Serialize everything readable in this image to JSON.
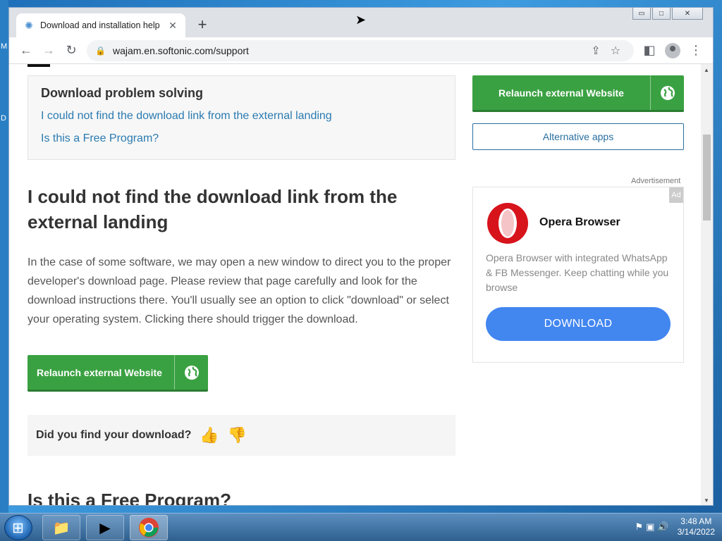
{
  "desktop": {
    "edge_letters": [
      "M",
      "D"
    ]
  },
  "browser": {
    "tab": {
      "title": "Download and installation help",
      "close": "✕",
      "favicon": "softonic-icon"
    },
    "new_tab": "+",
    "window_controls": {
      "minimize": "▭",
      "maximize": "□",
      "close": "✕"
    },
    "nav": {
      "back": "←",
      "forward": "→",
      "reload": "↻"
    },
    "omnibox": {
      "lock": "🔒",
      "url": "wajam.en.softonic.com/support"
    },
    "toolbar_icons": {
      "share": "⇪",
      "bookmark": "☆",
      "sidepanel": "◧",
      "menu": "⋮"
    }
  },
  "page": {
    "problem_box": {
      "heading": "Download problem solving",
      "links": [
        "I could not find the download link from the external landing",
        "Is this a Free Program?"
      ]
    },
    "section_title": "I could not find the download link from the external landing",
    "paragraph": "In the case of some software, we may open a new window to direct you to the proper developer's download page. Please review that page carefully and look for the download instructions there. You'll usually see an option to click \"download\" or select your operating system. Clicking there should trigger the download.",
    "relaunch_label": "Relaunch external Website",
    "feedback": {
      "question": "Did you find your download?",
      "yes": "👍",
      "no": "👎"
    },
    "next_section_title": "Is this a Free Program?"
  },
  "sidebar": {
    "relaunch_label": "Relaunch external Website",
    "alternative_label": "Alternative apps",
    "advertisement_label": "Advertisement",
    "ad": {
      "badge": "Ad",
      "title": "Opera Browser",
      "description": "Opera Browser with integrated WhatsApp & FB Messenger. Keep chatting while you browse",
      "cta": "DOWNLOAD"
    }
  },
  "colors": {
    "green": "#3aa142",
    "link": "#2a7ab0",
    "ad_button": "#4286f0",
    "opera_red": "#d7131c"
  },
  "taskbar": {
    "apps": [
      "file-explorer-icon",
      "media-player-icon",
      "chrome-icon"
    ],
    "clock": {
      "time": "3:48 AM",
      "date": "3/14/2022"
    }
  }
}
